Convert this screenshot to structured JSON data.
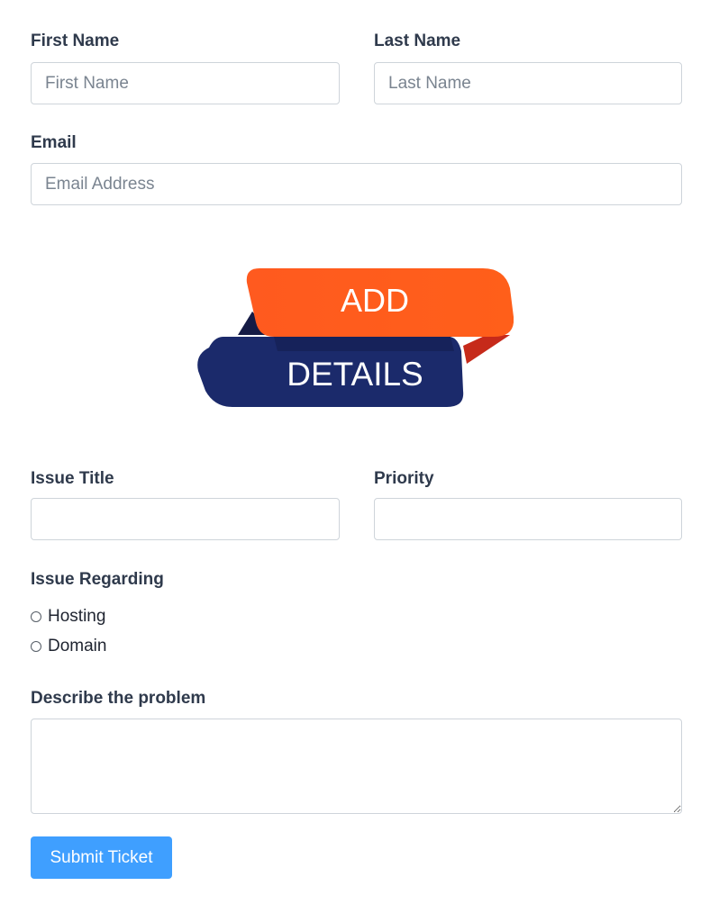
{
  "form": {
    "first_name": {
      "label": "First Name",
      "placeholder": "First Name",
      "value": ""
    },
    "last_name": {
      "label": "Last Name",
      "placeholder": "Last Name",
      "value": ""
    },
    "email": {
      "label": "Email",
      "placeholder": "Email Address",
      "value": ""
    },
    "banner": {
      "line1": "ADD",
      "line2": "DETAILS",
      "colors": {
        "top": "#ff5a1f",
        "bottom": "#1b2a6b"
      }
    },
    "issue_title": {
      "label": "Issue Title",
      "value": ""
    },
    "priority": {
      "label": "Priority",
      "value": ""
    },
    "issue_regarding": {
      "label": "Issue Regarding",
      "options": [
        "Hosting",
        "Domain"
      ],
      "selected": null
    },
    "problem": {
      "label": "Describe the problem",
      "value": ""
    },
    "submit_label": "Submit Ticket"
  },
  "colors": {
    "accent": "#3f9fff",
    "label": "#2f3a4c",
    "border": "#ced4da"
  }
}
